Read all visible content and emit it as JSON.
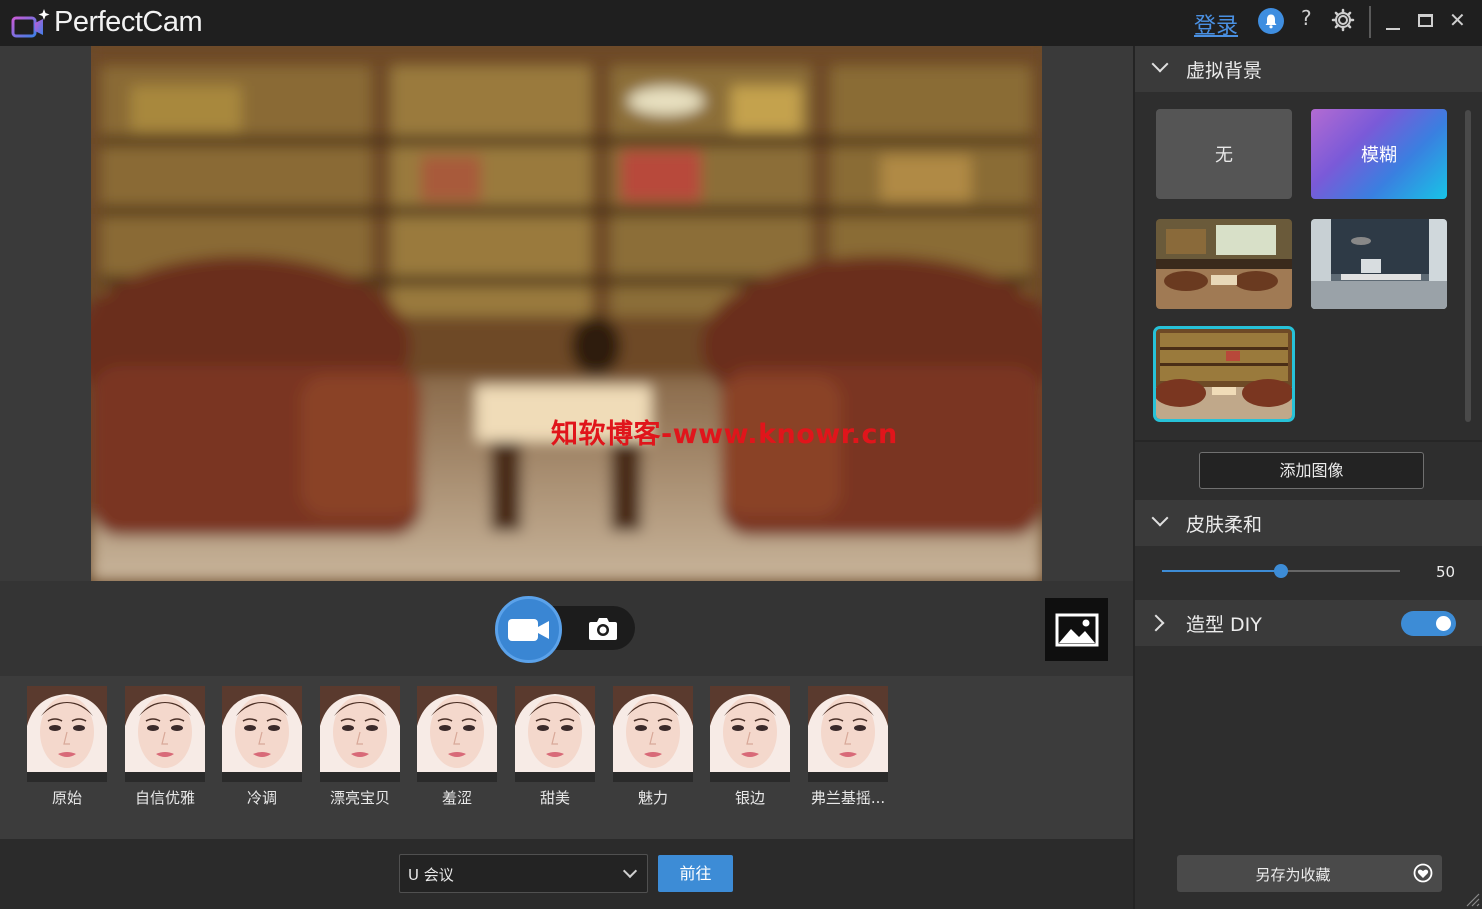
{
  "window": {
    "app_title": "PerfectCam",
    "login_label": "登录",
    "help_label": "?",
    "close_label": "✕"
  },
  "preview": {
    "watermark_text": "知软博客-www.knowr.cn"
  },
  "looks": [
    {
      "label": "原始"
    },
    {
      "label": "自信优雅"
    },
    {
      "label": "冷调"
    },
    {
      "label": "漂亮宝贝"
    },
    {
      "label": "羞涩"
    },
    {
      "label": "甜美"
    },
    {
      "label": "魅力"
    },
    {
      "label": "银边"
    },
    {
      "label": "弗兰基摇..."
    }
  ],
  "bottom_bar": {
    "app_select_value": "U 会议",
    "go_label": "前往"
  },
  "panel": {
    "virtual_bg": {
      "title": "虚拟背景",
      "none_label": "无",
      "blur_label": "模糊",
      "add_image_label": "添加图像"
    },
    "skin": {
      "title": "皮肤柔和",
      "value": "50",
      "level": 50,
      "max": 100
    },
    "makeup_diy": {
      "title": "造型 DIY",
      "enabled": true
    },
    "save_favorite_label": "另存为收藏"
  },
  "colors": {
    "accent": "#3d8cd6",
    "selected_outline": "#27c2d8",
    "watermark": "#e0151b"
  }
}
